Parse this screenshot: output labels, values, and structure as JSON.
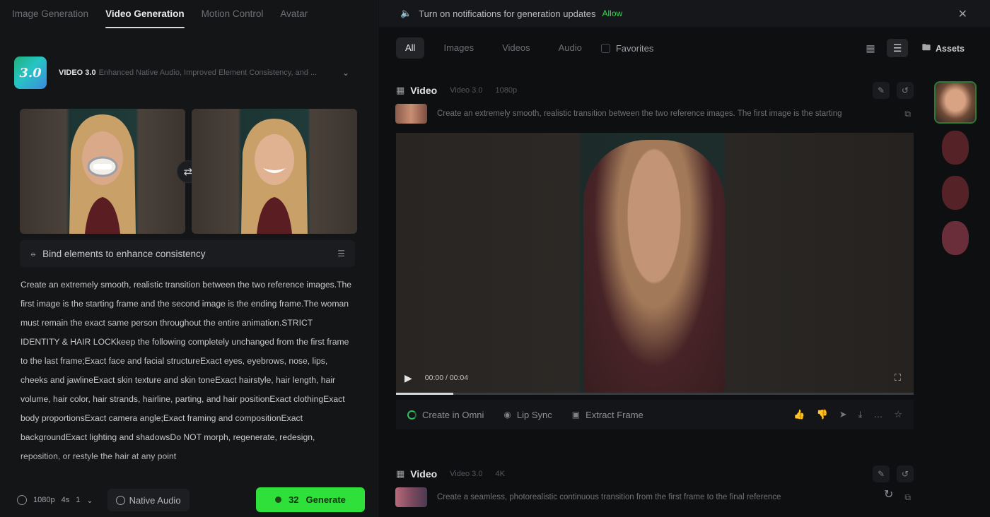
{
  "top_tabs": [
    "Image Generation",
    "Video Generation",
    "Motion Control",
    "Avatar"
  ],
  "active_tab": "Video Generation",
  "model": {
    "badge": "3.0",
    "name": "VIDEO 3.0",
    "description": "Enhanced Native Audio, Improved Element Consistency, and ..."
  },
  "bind_bar": {
    "label": "Bind elements to enhance consistency"
  },
  "prompt_text": "Create an extremely smooth, realistic transition between the two reference images.The first image is the starting frame and the second image is the ending frame.The woman must remain the exact same person throughout the entire animation.STRICT IDENTITY & HAIR LOCKkeep the following completely unchanged from the first frame to the last frame;Exact face and facial structureExact eyes, eyebrows, nose, lips, cheeks and jawlineExact skin texture and skin toneExact hairstyle, hair length, hair volume, hair color, hair strands, hairline, parting, and hair positionExact clothingExact body proportionsExact camera angle;Exact framing and compositionExact backgroundExact lighting and shadowsDo NOT morph, regenerate, redesign, reposition, or restyle the hair at any point",
  "bottom_bar": {
    "resolution": "1080p",
    "duration": "4s",
    "count": "1",
    "native_audio": "Native Audio",
    "generate_cost": "32",
    "generate_label": "Generate"
  },
  "notification": {
    "text": "Turn on notifications for generation updates",
    "allow": "Allow"
  },
  "filters": [
    "All",
    "Images",
    "Videos",
    "Audio"
  ],
  "active_filter": "All",
  "favorites_label": "Favorites",
  "folder_label": "Assets",
  "cards": [
    {
      "title": "Video",
      "model": "Video 3.0",
      "resolution": "1080p",
      "prompt": "Create an extremely smooth, realistic transition between the two reference images. The first image is the starting"
    },
    {
      "title": "Video",
      "model": "Video 3.0",
      "resolution": "4K",
      "prompt": "Create a seamless, photorealistic continuous transition from the first frame to the final reference"
    }
  ],
  "player": {
    "time": "00:00 / 00:04",
    "progress_fraction": 0.11
  },
  "actions": {
    "create_in_omni": "Create in Omni",
    "lip_sync": "Lip Sync",
    "extract_frame": "Extract Frame"
  },
  "colors": {
    "accent_green": "#2fe03a",
    "allow_green": "#3fd25b",
    "panel_bg": "#141517"
  },
  "icons": {
    "swap": "swap-arrows-icon",
    "bind": "bind-icon",
    "adjust": "sliders-icon",
    "bell": "speaker-icon",
    "close": "close-icon",
    "grid_view": "grid-icon",
    "list_view": "list-icon",
    "folder": "folder-icon"
  }
}
